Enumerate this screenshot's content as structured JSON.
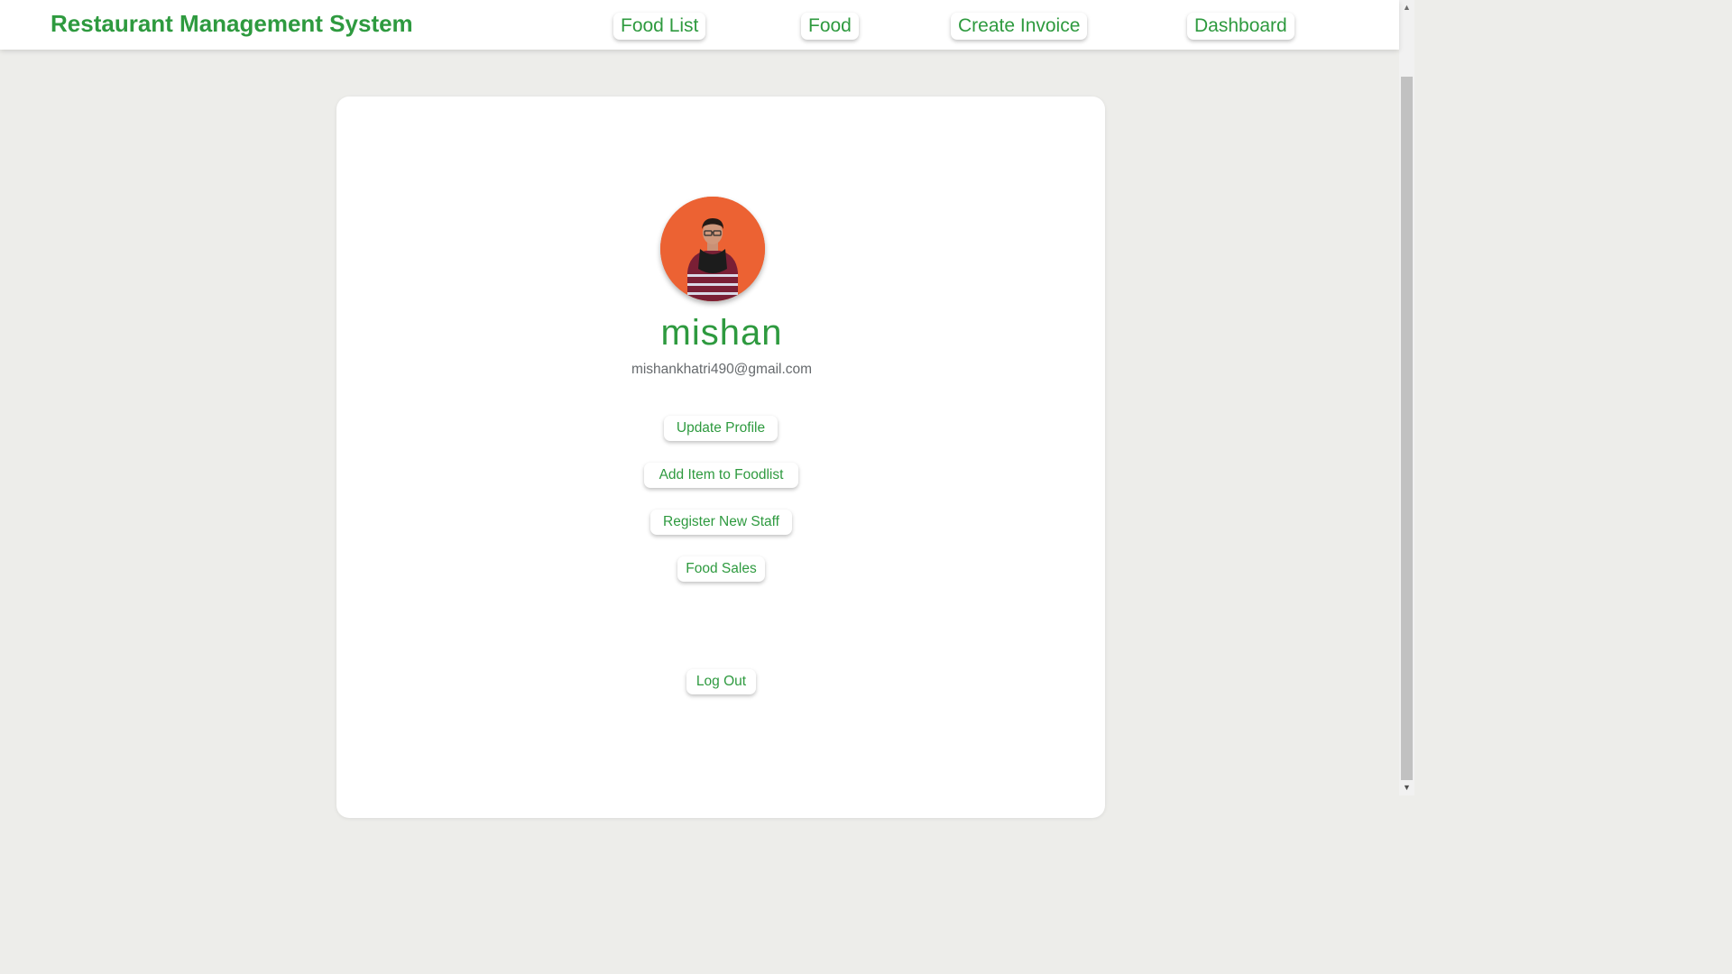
{
  "header": {
    "title": "Restaurant Management System",
    "nav": [
      "Food List",
      "Food",
      "Create Invoice",
      "Dashboard"
    ]
  },
  "profile": {
    "avatar_icon": "user-avatar-photo",
    "name": "mishan",
    "email": "mishankhatri490@gmail.com"
  },
  "actions": [
    "Update Profile",
    "Add Item to Foodlist",
    "Register New Staff",
    "Food Sales"
  ],
  "logout_label": "Log Out",
  "scrollbar": {
    "up_icon": "▲",
    "down_icon": "▼"
  },
  "colors": {
    "accent": "#2e9a3f",
    "page_background": "#ededea",
    "avatar_background": "#ec6233",
    "email_text": "#666a6d"
  }
}
